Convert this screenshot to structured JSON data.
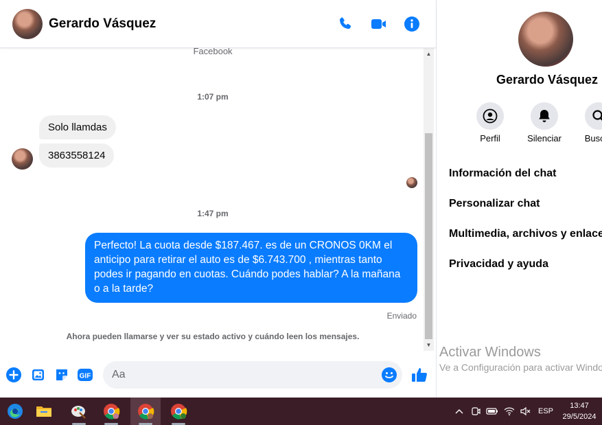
{
  "chat": {
    "contact_name": "Gerardo Vásquez",
    "header_icons": [
      "phone-icon",
      "video-camera-icon",
      "info-icon"
    ],
    "source_label": "Facebook",
    "messages": [
      {
        "type": "timestamp",
        "text": "1:07 pm"
      },
      {
        "type": "incoming",
        "text": "Solo llamdas"
      },
      {
        "type": "incoming",
        "text": "3863558124"
      },
      {
        "type": "timestamp",
        "text": "1:47 pm"
      },
      {
        "type": "outgoing",
        "text": "Perfecto! La cuota desde $187.467. es de un CRONOS 0KM el anticipo para retirar el auto es de $6.743.700 , mientras tanto podes ir pagando en cuotas. Cuándo podes hablar? A la mañana o a la tarde?"
      }
    ],
    "delivery_status": "Enviado",
    "activity_note": "Ahora pueden llamarse y ver su estado activo y cuándo leen los mensajes.",
    "composer": {
      "placeholder": "Aa",
      "icons": [
        "plus-icon",
        "image-icon",
        "sticker-icon",
        "gif-icon",
        "emoji-icon",
        "like-icon"
      ],
      "gif_label": "GIF"
    }
  },
  "details": {
    "name": "Gerardo Vásquez",
    "actions": [
      {
        "label": "Perfil",
        "icon": "profile-icon"
      },
      {
        "label": "Silenciar",
        "icon": "bell-icon"
      },
      {
        "label": "Buscar",
        "icon": "search-icon"
      }
    ],
    "menu": [
      "Información del chat",
      "Personalizar chat",
      "Multimedia, archivos y enlaces",
      "Privacidad y ayuda"
    ],
    "watermark_title": "Activar Windows",
    "watermark_subtitle": "Ve a Configuración para activar Windows."
  },
  "taskbar": {
    "apps": [
      "edge-icon",
      "file-explorer-icon",
      "paint-icon",
      "chrome-icon",
      "chrome-icon",
      "chrome-icon"
    ],
    "language": "ESP",
    "time": "13:47",
    "date": "29/5/2024"
  },
  "colors": {
    "accent": "#0a7cff",
    "incoming_bubble": "#f0f0f0",
    "taskbar": "#3b1d27"
  }
}
